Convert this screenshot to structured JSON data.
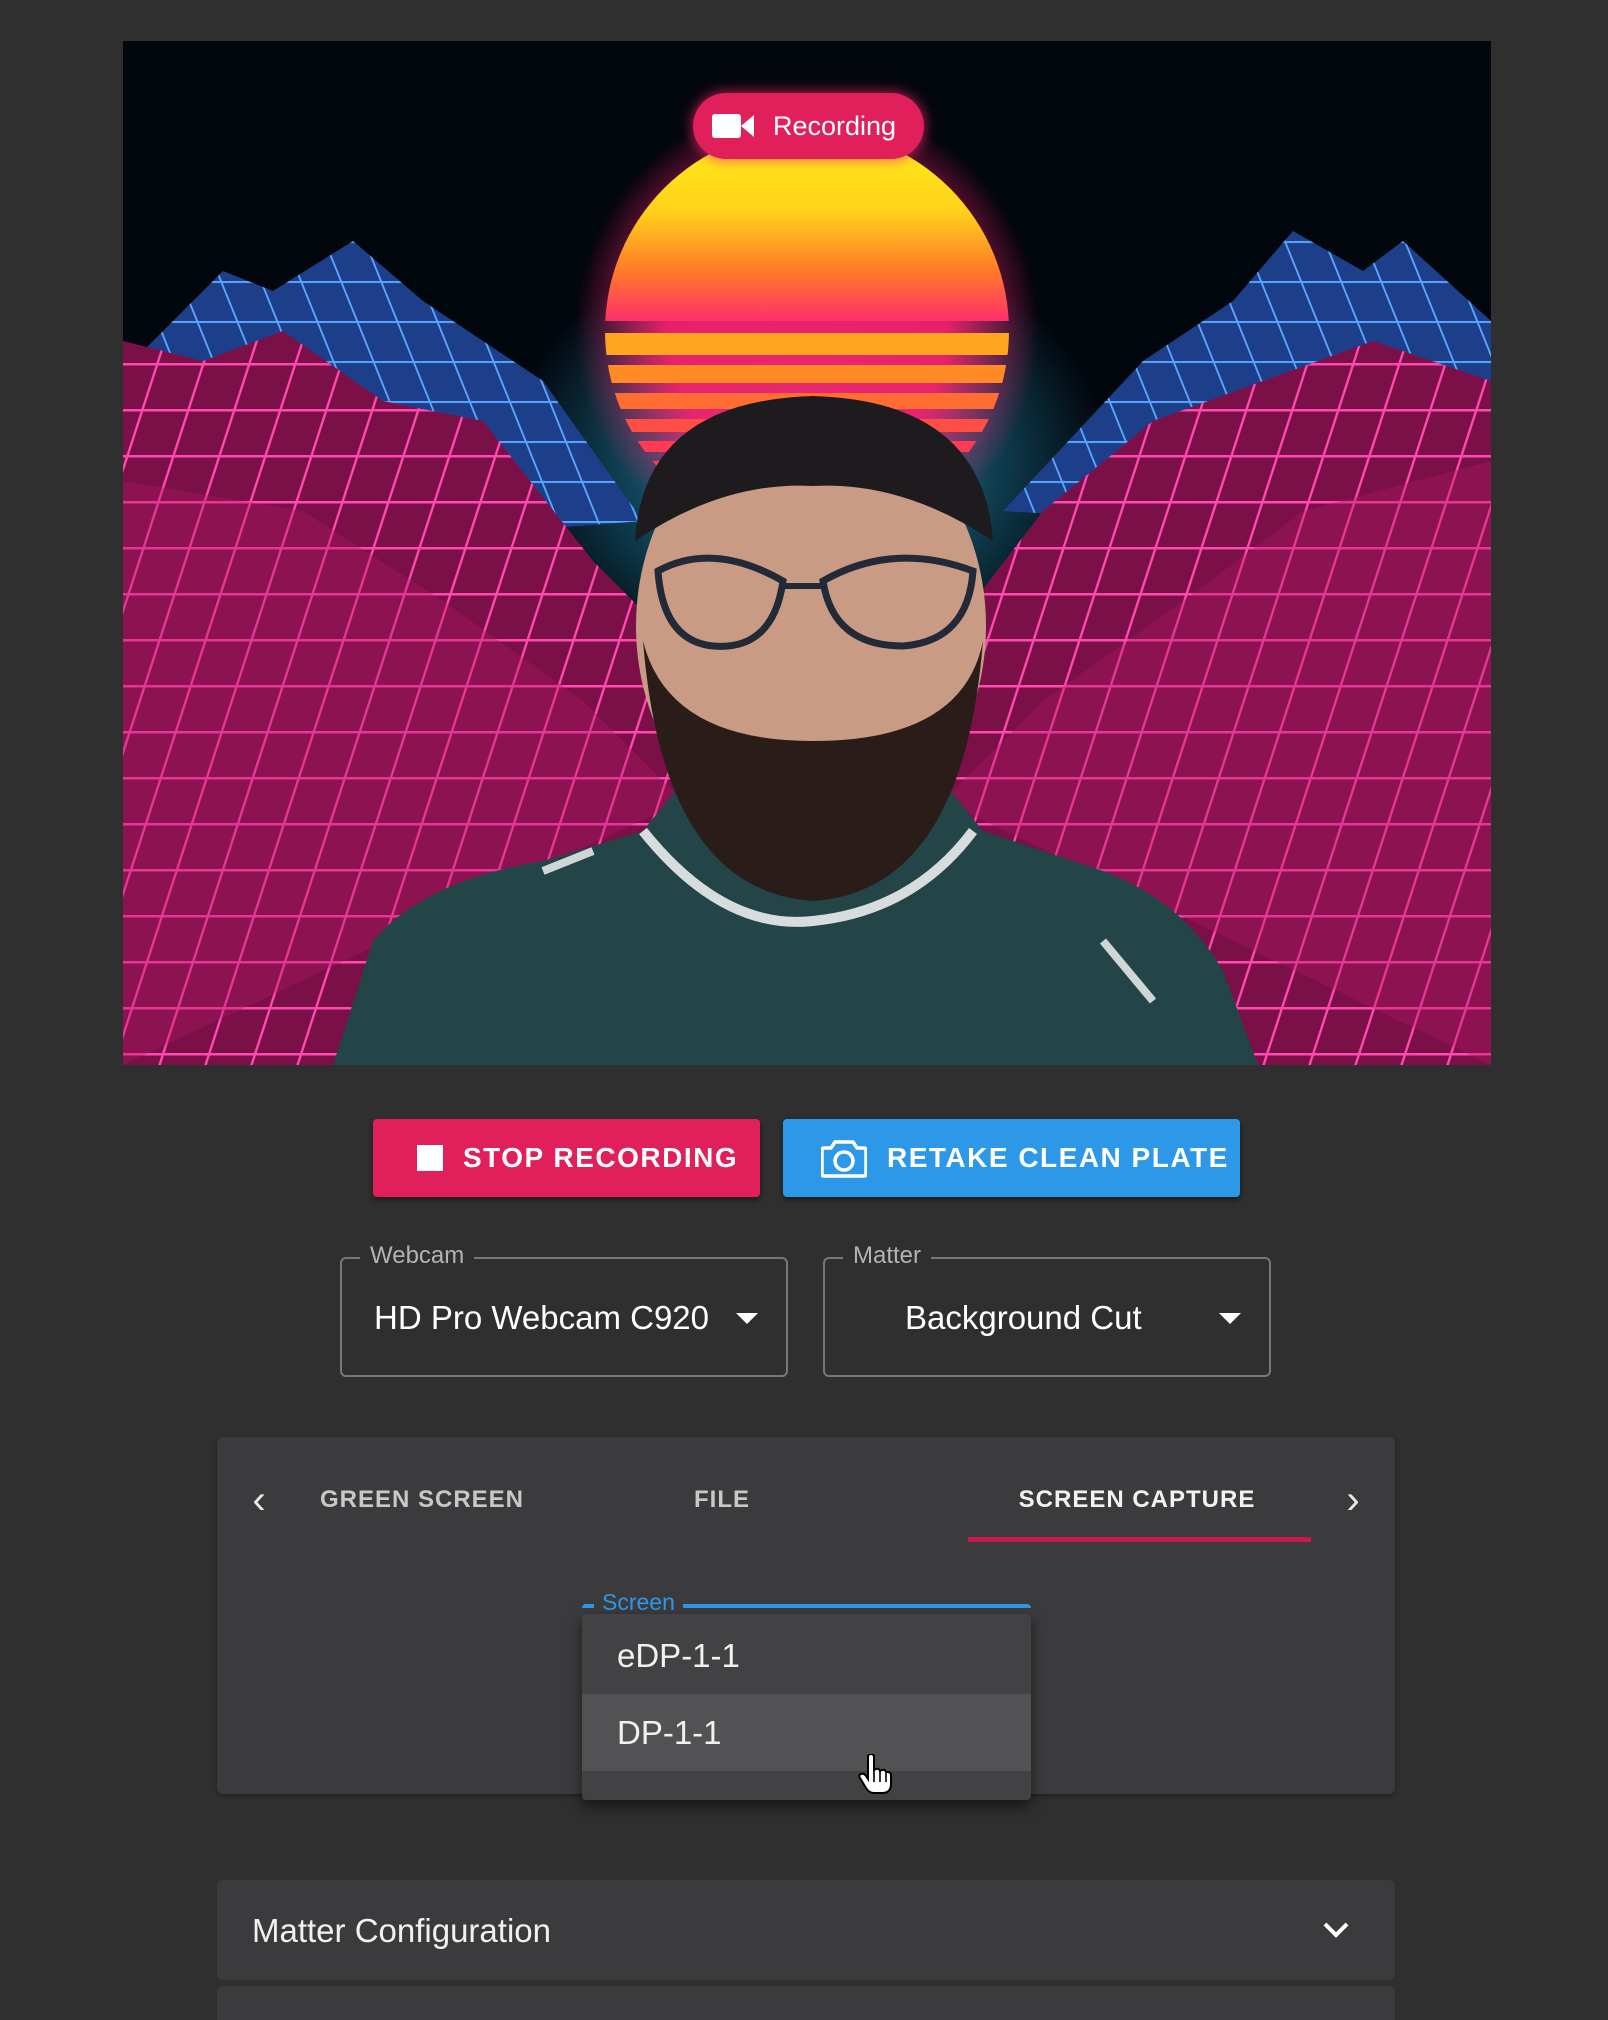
{
  "recording_badge": {
    "label": "Recording",
    "icon": "videocam-icon"
  },
  "actions": {
    "stop_label": "STOP RECORDING",
    "retake_label": "RETAKE CLEAN PLATE"
  },
  "webcam": {
    "label": "Webcam",
    "value": "HD Pro Webcam C920"
  },
  "matter": {
    "label": "Matter",
    "value": "Background Cut"
  },
  "source_tabs": {
    "items": [
      "GREEN SCREEN",
      "FILE",
      "SCREEN CAPTURE"
    ],
    "selected": "SCREEN CAPTURE"
  },
  "screen": {
    "label": "Screen",
    "options": [
      "eDP-1-1",
      "DP-1-1"
    ],
    "hovered": "DP-1-1"
  },
  "matter_config": {
    "title": "Matter Configuration"
  },
  "colors": {
    "background": "#2f2f2f",
    "panel": "#3b3b3d",
    "accent_pink": "#e01f5b",
    "accent_blue": "#2d98e8"
  }
}
